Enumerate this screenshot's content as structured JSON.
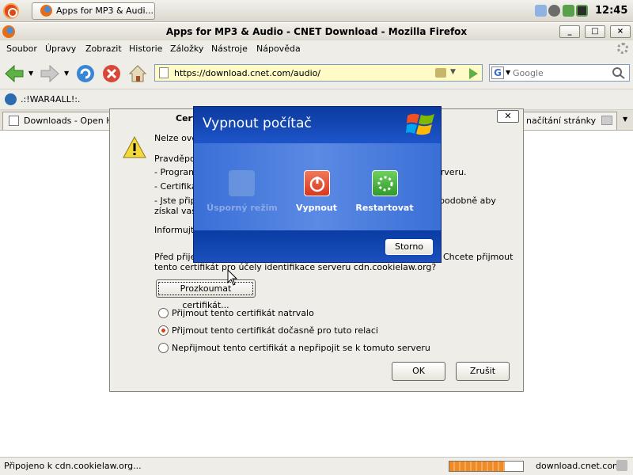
{
  "panel": {
    "taskbar_label": "Apps for MP3 & Audi...",
    "clock": "12:45"
  },
  "window": {
    "title": "Apps for MP3 & Audio - CNET Download - Mozilla Firefox",
    "min_label": "_",
    "max_label": "□",
    "close_label": "×"
  },
  "menu": [
    "Soubor",
    "Úpravy",
    "Zobrazit",
    "Historie",
    "Záložky",
    "Nástroje",
    "Nápověda"
  ],
  "nav": {
    "url": "https://download.cnet.com/audio/",
    "search_placeholder": "Google",
    "search_engine_letter": "G"
  },
  "bookmarks": {
    "item": ".:!WAR4ALL!:."
  },
  "tabs": {
    "first": "Downloads - Open Han",
    "second": "načítání stránky"
  },
  "cert_dialog": {
    "title_fragment": "Certi",
    "line_top": "Nelze ově",
    "line_prob": "Pravděpod",
    "bullet1": "- Program",
    "bullet1_end": "erveru.",
    "bullet2": "- Certifikát",
    "bullet3": "- Jste připo",
    "bullet3_end": "podobně aby",
    "bullet3b": "získal vaše",
    "info": "Informujte",
    "before": "Před přijet",
    "before_end": "Chcete přijmout",
    "purpose": "tento certifikát pro účely identifikace serveru cdn.cookielaw.org?",
    "examine_button": "Prozkoumat certifikát...",
    "options": [
      "Přijmout tento certifikát natrvalo",
      "Přijmout tento certifikát dočasně pro tuto relaci",
      "Nepřijmout tento certifikát a nepřipojit se k tomuto serveru"
    ],
    "selected_index": 1,
    "ok": "OK",
    "cancel": "Zrušit"
  },
  "shutdown_dialog": {
    "title": "Vypnout počítač",
    "options": [
      "Úsporný režim",
      "Vypnout",
      "Restartovat"
    ],
    "cancel": "Storno"
  },
  "status": {
    "left": "Připojeno k cdn.cookielaw.org...",
    "right": "download.cnet.com",
    "progress": 0.75
  },
  "colors": {
    "shutdown_blue": "#1b4aa8",
    "power_red": "#d9361d",
    "restart_green": "#2f9a2c",
    "progress_orange": "#f08a24"
  }
}
